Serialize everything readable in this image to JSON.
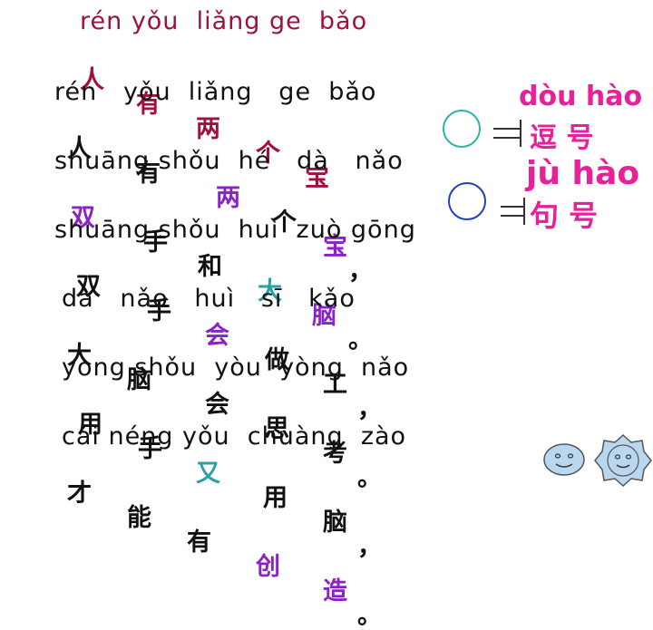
{
  "poem": {
    "title_pinyin": "rén yǒu  liǎng ge  bǎo",
    "title_hanzi": [
      "人",
      "有",
      "两",
      "个",
      "宝"
    ],
    "lines": [
      {
        "pinyin": "rén   yǒu  liǎng   ge  bǎo",
        "hanzi": [
          "人",
          "有",
          "两",
          "个",
          "宝",
          "，"
        ]
      },
      {
        "pinyin": "shuāng shǒu  hé   dà   nǎo",
        "hanzi": [
          "双",
          "手",
          "和",
          "大",
          "脑",
          "。"
        ]
      },
      {
        "pinyin": "shuāng shǒu  huì  zuò gōng",
        "hanzi": [
          "双",
          "手",
          "会",
          "做",
          "工",
          "，"
        ]
      },
      {
        "pinyin": "dà   nǎo   huì   sī   kǎo",
        "hanzi": [
          "大",
          "脑",
          "会",
          "思",
          "考",
          "。"
        ]
      },
      {
        "pinyin": "yòng shǒu  yòu  yòng  nǎo",
        "hanzi": [
          "用",
          "手",
          "又",
          "用",
          "脑",
          "，"
        ]
      },
      {
        "pinyin": "cái néng yǒu  chuàng  zào",
        "hanzi": [
          "才",
          "能",
          "有",
          "创",
          "造",
          "。"
        ]
      }
    ]
  },
  "punctuation": {
    "comma_pinyin": "dòu hào",
    "comma_hanzi": "逗 号",
    "period_pinyin": "jù hào",
    "period_hanzi": "句 号"
  },
  "colors": {
    "title": "#a0103f",
    "purple": "#8a22c9",
    "teal": "#2aa0a8",
    "pink": "#e8209a",
    "comma_circle": "#2bb3a3",
    "period_circle": "#1f3fbf",
    "face": "#b9d7ef"
  },
  "icons": [
    "smiley-face-icon",
    "sun-face-icon"
  ]
}
